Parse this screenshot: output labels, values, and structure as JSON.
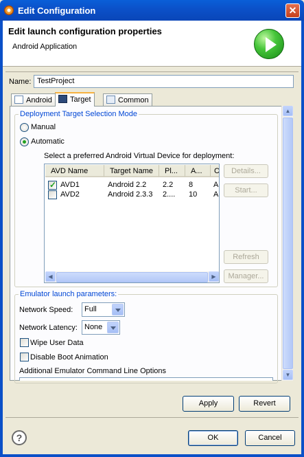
{
  "window": {
    "title": "Edit Configuration",
    "close_glyph": "✕"
  },
  "header": {
    "title": "Edit launch configuration properties",
    "subtitle": "Android Application",
    "icon": "run-play-icon"
  },
  "name_field": {
    "label": "Name:",
    "value": "TestProject"
  },
  "tabs": [
    {
      "label": "Android",
      "icon": "android-tab-icon",
      "active": false
    },
    {
      "label": "Target",
      "icon": "target-tab-icon",
      "active": true
    },
    {
      "label": "Common",
      "icon": "common-tab-icon",
      "active": false
    }
  ],
  "deployment": {
    "legend": "Deployment Target Selection Mode",
    "manual_label": "Manual",
    "automatic_label": "Automatic",
    "selected": "Automatic",
    "avd_prompt": "Select a preferred Android Virtual Device for deployment:",
    "columns": [
      "AVD Name",
      "Target Name",
      "Pl...",
      "A...",
      "C"
    ],
    "rows": [
      {
        "checked": true,
        "cells": [
          "AVD1",
          "Android 2.2",
          "2.2",
          "8",
          "A"
        ]
      },
      {
        "checked": false,
        "cells": [
          "AVD2",
          "Android 2.3.3",
          "2....",
          "10",
          "A"
        ]
      }
    ],
    "buttons": {
      "details": "Details...",
      "start": "Start...",
      "refresh": "Refresh",
      "manager": "Manager..."
    }
  },
  "emulator": {
    "legend": "Emulator launch parameters:",
    "network_speed_label": "Network Speed:",
    "network_speed_value": "Full",
    "network_latency_label": "Network Latency:",
    "network_latency_value": "None",
    "wipe_label": "Wipe User Data",
    "wipe_checked": false,
    "disable_boot_label": "Disable Boot Animation",
    "disable_boot_checked": false,
    "cmdline_label": "Additional Emulator Command Line Options"
  },
  "actions": {
    "apply": "Apply",
    "revert": "Revert",
    "ok": "OK",
    "cancel": "Cancel",
    "help_glyph": "?"
  },
  "colors": {
    "title_bar": "#0b50c8",
    "group_legend": "#0046d5",
    "dialog_bg": "#ece9d8"
  }
}
